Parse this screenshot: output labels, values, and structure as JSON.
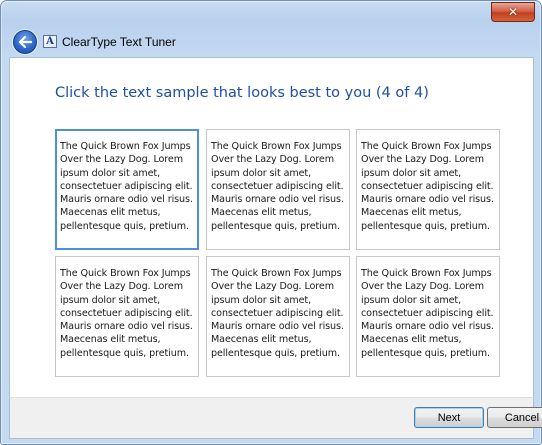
{
  "window": {
    "close_glyph": "✕"
  },
  "header": {
    "back_icon": "back-arrow-icon",
    "app_icon_glyph": "A",
    "app_title": "ClearType Text Tuner"
  },
  "main": {
    "instruction": "Click the text sample that looks best to you (4 of 4)",
    "selected_index": 0,
    "samples": [
      {
        "text": "The Quick Brown Fox Jumps\nOver the Lazy Dog. Lorem\nipsum dolor sit amet,\nconsectetuer adipiscing elit.\nMauris ornare odio vel risus.\nMaecenas elit metus,\npellentesque quis, pretium."
      },
      {
        "text": "The Quick Brown Fox Jumps\nOver the Lazy Dog. Lorem\nipsum dolor sit amet,\nconsectetuer adipiscing elit.\nMauris ornare odio vel risus.\nMaecenas elit metus,\npellentesque quis, pretium."
      },
      {
        "text": "The Quick Brown Fox Jumps\nOver the Lazy Dog. Lorem\nipsum dolor sit amet,\nconsectetuer adipiscing elit.\nMauris ornare odio vel risus.\nMaecenas elit metus,\npellentesque quis, pretium."
      },
      {
        "text": "The Quick Brown Fox Jumps\nOver the Lazy Dog. Lorem\nipsum dolor sit amet,\nconsectetuer adipiscing elit.\nMauris ornare odio vel risus.\nMaecenas elit metus,\npellentesque quis, pretium."
      },
      {
        "text": "The Quick Brown Fox Jumps\nOver the Lazy Dog. Lorem\nipsum dolor sit amet,\nconsectetuer adipiscing elit.\nMauris ornare odio vel risus.\nMaecenas elit metus,\npellentesque quis, pretium."
      },
      {
        "text": "The Quick Brown Fox Jumps\nOver the Lazy Dog. Lorem\nipsum dolor sit amet,\nconsectetuer adipiscing elit.\nMauris ornare odio vel risus.\nMaecenas elit metus,\npellentesque quis, pretium."
      }
    ]
  },
  "footer": {
    "next_label": "Next",
    "cancel_label": "Cancel"
  },
  "colors": {
    "instruction_text": "#1e4fa3",
    "selected_border": "#4b90d8",
    "title_bar": "#c5daf2",
    "close_button": "#c3401f"
  }
}
